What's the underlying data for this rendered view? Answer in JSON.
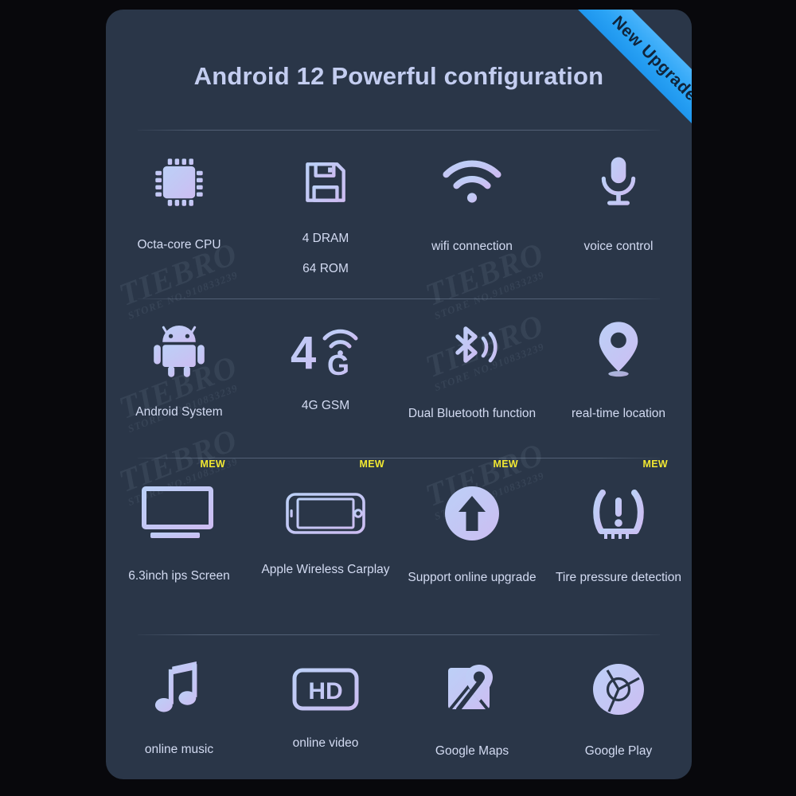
{
  "card": {
    "title": "Android 12 Powerful configuration",
    "ribbon_label": "New Upgrade",
    "background_color": "#2a3648",
    "page_background_color": "#08080c",
    "ribbon_color": "#2aa3f5",
    "icon_color": "#c6cdf3",
    "caption_color": "#d3dbf2",
    "badge_color": "#f2e832"
  },
  "watermark": {
    "main": "TIEBRO",
    "sub": "STORE NO.910833239"
  },
  "rows": [
    {
      "cells": [
        {
          "icon": "cpu-chip-icon",
          "label": "Octa-core  CPU",
          "label2": "",
          "badge": ""
        },
        {
          "icon": "floppy-disk-icon",
          "label": "4 DRAM",
          "label2": "64  ROM",
          "badge": ""
        },
        {
          "icon": "wifi-icon",
          "label": "wifi connection",
          "label2": "",
          "badge": ""
        },
        {
          "icon": "microphone-icon",
          "label": "voice control",
          "label2": "",
          "badge": ""
        }
      ]
    },
    {
      "cells": [
        {
          "icon": "android-robot-icon",
          "label": "Android System",
          "label2": "",
          "badge": ""
        },
        {
          "icon": "4g-signal-icon",
          "label": "4G GSM",
          "label2": "",
          "badge": ""
        },
        {
          "icon": "bluetooth-icon",
          "label": "Dual Bluetooth function",
          "label2": "",
          "badge": ""
        },
        {
          "icon": "map-pin-icon",
          "label": "real-time location",
          "label2": "",
          "badge": ""
        }
      ]
    },
    {
      "cells": [
        {
          "icon": "monitor-screen-icon",
          "label": "6.3inch ips Screen",
          "label2": "",
          "badge": "MEW"
        },
        {
          "icon": "smartphone-icon",
          "label": "Apple Wireless Carplay",
          "label2": "",
          "badge": "MEW"
        },
        {
          "icon": "upgrade-arrow-icon",
          "label": "Support online upgrade",
          "label2": "",
          "badge": "MEW"
        },
        {
          "icon": "tire-pressure-icon",
          "label": "Tire pressure detection",
          "label2": "",
          "badge": "MEW"
        }
      ]
    },
    {
      "cells": [
        {
          "icon": "music-note-icon",
          "label": "online music",
          "label2": "",
          "badge": ""
        },
        {
          "icon": "hd-badge-icon",
          "label": "online video",
          "label2": "",
          "badge": ""
        },
        {
          "icon": "google-maps-icon",
          "label": "Google Maps",
          "label2": "",
          "badge": ""
        },
        {
          "icon": "chrome-icon",
          "label": "Google Play",
          "label2": "",
          "badge": ""
        }
      ]
    }
  ]
}
